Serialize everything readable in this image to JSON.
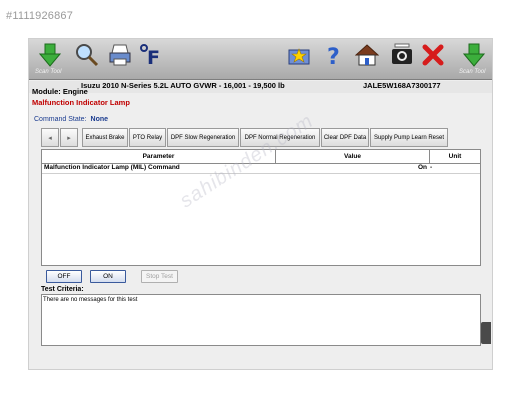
{
  "listing_id": "#1111926867",
  "watermark": "sahibinden.com",
  "toolbar": {
    "scan_tool_left": "Scan Tool",
    "scan_tool_right": "Scan Tool",
    "icons": [
      "down-arrow-icon",
      "search-icon",
      "printer-icon",
      "fahrenheit-icon",
      "star-folder-icon",
      "help-icon",
      "home-icon",
      "camera-icon",
      "close-icon",
      "down-arrow-icon"
    ]
  },
  "vehicle": {
    "description": "Isuzu  2010  N-Series  5.2L  AUTO GVWR - 16,001 - 19,500 lb",
    "vin": "JALE5W168A7300177"
  },
  "module_label": "Module: Engine",
  "component_label": "Malfunction Indicator Lamp",
  "command_state": {
    "label": "Command State:",
    "value": "None"
  },
  "tabs": {
    "prev": "◂",
    "next": "▸",
    "items": [
      "Exhaust Brake",
      "PTO Relay",
      "DPF Slow Regeneration",
      "DPF Normal Regeneration",
      "Clear DPF Data",
      "Supply Pump Learn Reset"
    ]
  },
  "grid": {
    "headers": {
      "parameter": "Parameter",
      "value": "Value",
      "unit": "Unit"
    },
    "rows": [
      {
        "parameter": "Malfunction Indicator Lamp (MIL) Command",
        "value": "On",
        "unit": "-"
      }
    ]
  },
  "buttons": {
    "off": "OFF",
    "on": "ON",
    "stop": "Stop Test"
  },
  "test_criteria": {
    "label": "Test Criteria:",
    "message": "There are no messages for this test"
  },
  "colors": {
    "component_red": "#c00000",
    "command_blue": "#1a3b8f",
    "toolbar_grey": "#a9a9a9"
  }
}
